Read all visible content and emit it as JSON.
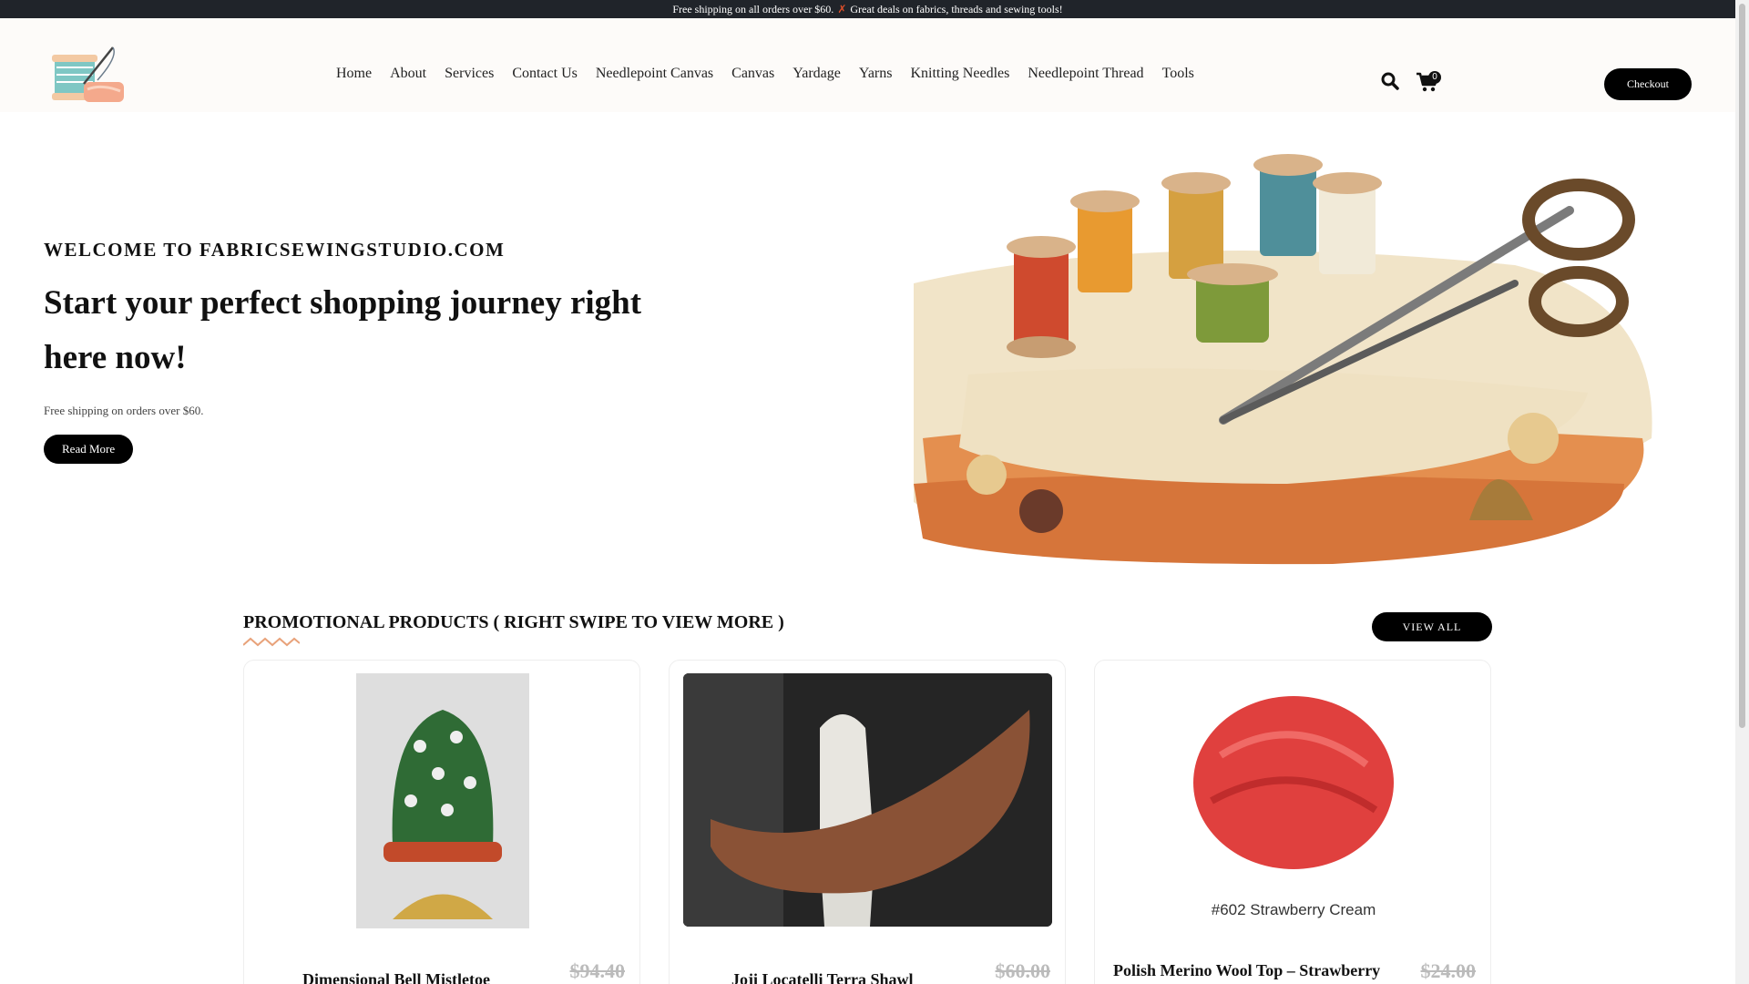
{
  "announcement": {
    "left": "Free shipping on all orders over $60.",
    "icon": "close-icon",
    "right": "Great deals on fabrics, threads and sewing tools!"
  },
  "header": {
    "logo_icon": "thread-spool-needle-icon",
    "nav": [
      "Home",
      "About",
      "Services",
      "Contact Us",
      "Needlepoint Canvas",
      "Canvas",
      "Yardage",
      "Yarns",
      "Knitting Needles",
      "Needlepoint Thread",
      "Tools"
    ],
    "cart_count": "0",
    "checkout_label": "Checkout"
  },
  "hero": {
    "welcome": "WELCOME TO FABRICSEWINGSTUDIO.COM",
    "headline": "Start your perfect shopping journey right here now!",
    "subtext": "Free shipping on orders over $60.",
    "read_more_label": "Read More"
  },
  "promo": {
    "title": "PROMOTIONAL PRODUCTS ( RIGHT SWIPE TO VIEW MORE )",
    "view_all_label": "VIEW ALL",
    "products": [
      {
        "name": "Dimensional Bell Mistletoe",
        "old_price": "$94.40"
      },
      {
        "name": "Joji Locatelli Terra Shawl",
        "old_price": "$60.00"
      },
      {
        "name": "Polish Merino Wool Top – Strawberry",
        "old_price": "$24.00",
        "image_caption": "#602 Strawberry Cream"
      }
    ]
  },
  "colors": {
    "topbar": "#20242a",
    "accent": "#000000",
    "wave": "#e8a27a"
  }
}
